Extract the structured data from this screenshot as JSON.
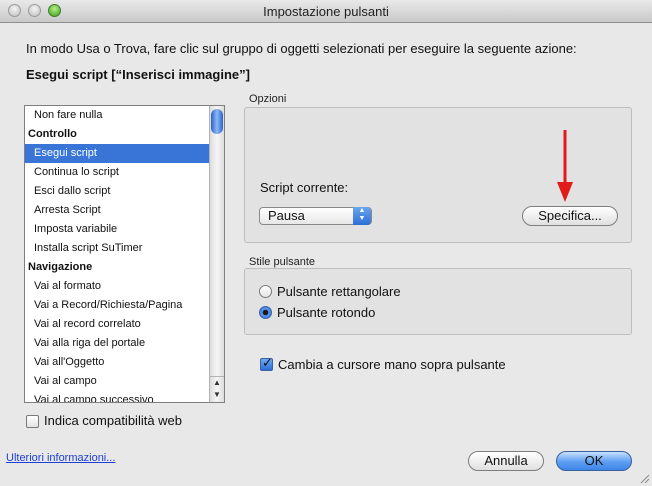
{
  "window": {
    "title": "Impostazione pulsanti"
  },
  "instruction": "In modo Usa o Trova, fare clic sul gruppo di oggetti selezionati per eseguire la seguente azione:",
  "current_action": "Esegui script [“Inserisci immagine”]",
  "action_list": {
    "items": [
      {
        "label": "Non fare nulla",
        "type": "item"
      },
      {
        "label": "Controllo",
        "type": "header"
      },
      {
        "label": "Esegui script",
        "type": "item",
        "selected": true
      },
      {
        "label": "Continua lo script",
        "type": "item"
      },
      {
        "label": "Esci dallo script",
        "type": "item"
      },
      {
        "label": "Arresta Script",
        "type": "item"
      },
      {
        "label": "Imposta variabile",
        "type": "item"
      },
      {
        "label": "Installa script SuTimer",
        "type": "item"
      },
      {
        "label": "Navigazione",
        "type": "header"
      },
      {
        "label": "Vai al formato",
        "type": "item"
      },
      {
        "label": "Vai a Record/Richiesta/Pagina",
        "type": "item"
      },
      {
        "label": "Vai al record correlato",
        "type": "item"
      },
      {
        "label": "Vai alla riga del portale",
        "type": "item"
      },
      {
        "label": "Vai all'Oggetto",
        "type": "item"
      },
      {
        "label": "Vai al campo",
        "type": "item"
      },
      {
        "label": "Vai al campo successivo",
        "type": "item"
      }
    ]
  },
  "web_compat": {
    "label": "Indica compatibilità web",
    "checked": false
  },
  "options": {
    "group_label": "Opzioni",
    "script_label": "Script corrente:",
    "script_popup_value": "Pausa",
    "specify_button": "Specifica..."
  },
  "button_style": {
    "group_label": "Stile pulsante",
    "rect_label": "Pulsante rettangolare",
    "round_label": "Pulsante rotondo",
    "selected": "round"
  },
  "hand_cursor": {
    "label": "Cambia a cursore mano sopra pulsante",
    "checked": true
  },
  "more_info_link": "Ulteriori informazioni...",
  "cancel_button": "Annulla",
  "ok_button": "OK",
  "colors": {
    "selection": "#3875d7",
    "annotation_arrow": "#e11a1a",
    "link": "#1d3fd6"
  }
}
